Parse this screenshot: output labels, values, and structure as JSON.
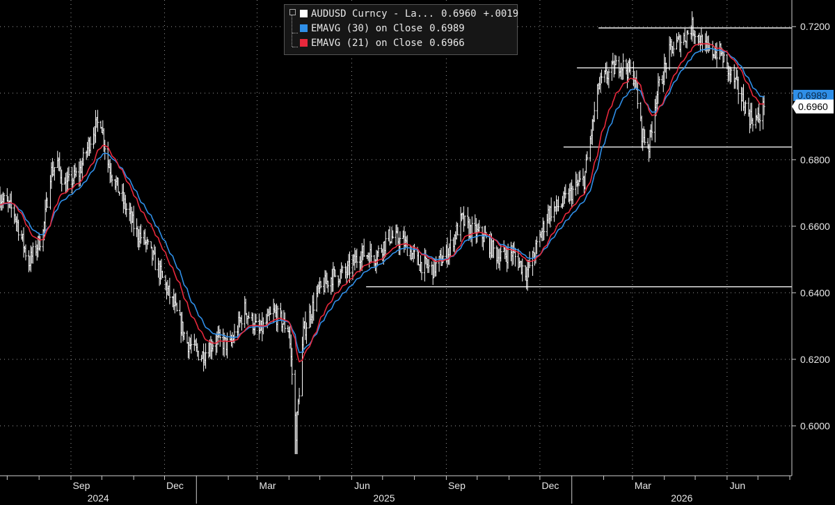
{
  "legend": {
    "main": {
      "label": "AUDUSD Curncy - La...",
      "value": "0.6960",
      "change": "+.0019",
      "color": "#ffffff"
    },
    "ema30": {
      "label": "EMAVG (30)  on Close",
      "value": "0.6989",
      "color": "#2f8fe8"
    },
    "ema21": {
      "label": "EMAVG (21)  on Close",
      "value": "0.6966",
      "color": "#e8283c"
    }
  },
  "chart_data": {
    "type": "line",
    "security": "AUDUSD Curncy",
    "ylim": [
      0.585,
      0.728
    ],
    "y_ticks": [
      "0.6000",
      "0.6200",
      "0.6400",
      "0.6600",
      "0.6800",
      "0.7000",
      "0.7200"
    ],
    "last_price_label": "0.6960",
    "ema30_label": "0.6989",
    "x_tick_labels": [
      "Sep",
      "Dec",
      "Mar",
      "Jun",
      "Sep",
      "Dec",
      "Mar",
      "Jun"
    ],
    "year_labels": [
      "2024",
      "2025",
      "2026"
    ],
    "x_start": "2024-06-24",
    "x_end": "2026-08-03",
    "price_path": [
      [
        "2024-06-24",
        0.669
      ],
      [
        "2024-07-08",
        0.664
      ],
      [
        "2024-07-22",
        0.649
      ],
      [
        "2024-08-05",
        0.658
      ],
      [
        "2024-08-12",
        0.676
      ],
      [
        "2024-08-19",
        0.679
      ],
      [
        "2024-08-26",
        0.672
      ],
      [
        "2024-09-09",
        0.676
      ],
      [
        "2024-09-23",
        0.689
      ],
      [
        "2024-09-30",
        0.692
      ],
      [
        "2024-10-07",
        0.679
      ],
      [
        "2024-10-21",
        0.668
      ],
      [
        "2024-11-04",
        0.658
      ],
      [
        "2024-11-11",
        0.656
      ],
      [
        "2024-11-25",
        0.647
      ],
      [
        "2024-12-09",
        0.637
      ],
      [
        "2024-12-23",
        0.625
      ],
      [
        "2025-01-06",
        0.621
      ],
      [
        "2025-01-20",
        0.626
      ],
      [
        "2025-02-03",
        0.624
      ],
      [
        "2025-02-17",
        0.635
      ],
      [
        "2025-03-03",
        0.628
      ],
      [
        "2025-03-17",
        0.634
      ],
      [
        "2025-04-01",
        0.629
      ],
      [
        "2025-04-08",
        0.598
      ],
      [
        "2025-04-15",
        0.628
      ],
      [
        "2025-04-29",
        0.64
      ],
      [
        "2025-05-13",
        0.645
      ],
      [
        "2025-05-27",
        0.646
      ],
      [
        "2025-06-10",
        0.652
      ],
      [
        "2025-06-24",
        0.651
      ],
      [
        "2025-07-08",
        0.657
      ],
      [
        "2025-07-22",
        0.655
      ],
      [
        "2025-08-05",
        0.649
      ],
      [
        "2025-08-19",
        0.647
      ],
      [
        "2025-09-02",
        0.652
      ],
      [
        "2025-09-16",
        0.662
      ],
      [
        "2025-09-23",
        0.659
      ],
      [
        "2025-10-07",
        0.657
      ],
      [
        "2025-10-21",
        0.651
      ],
      [
        "2025-11-04",
        0.652
      ],
      [
        "2025-11-18",
        0.646
      ],
      [
        "2025-11-25",
        0.651
      ],
      [
        "2025-12-09",
        0.664
      ],
      [
        "2025-12-23",
        0.667
      ],
      [
        "2026-01-06",
        0.672
      ],
      [
        "2026-01-13",
        0.674
      ],
      [
        "2026-01-20",
        0.688
      ],
      [
        "2026-01-27",
        0.702
      ],
      [
        "2026-02-03",
        0.705
      ],
      [
        "2026-02-17",
        0.709
      ],
      [
        "2026-03-03",
        0.705
      ],
      [
        "2026-03-10",
        0.688
      ],
      [
        "2026-03-17",
        0.684
      ],
      [
        "2026-03-24",
        0.699
      ],
      [
        "2026-04-07",
        0.713
      ],
      [
        "2026-04-21",
        0.717
      ],
      [
        "2026-04-28",
        0.72
      ],
      [
        "2026-05-12",
        0.713
      ],
      [
        "2026-05-26",
        0.712
      ],
      [
        "2026-06-02",
        0.707
      ],
      [
        "2026-06-09",
        0.703
      ],
      [
        "2026-06-16",
        0.698
      ],
      [
        "2026-06-23",
        0.693
      ],
      [
        "2026-07-01",
        0.692
      ],
      [
        "2026-07-07",
        0.696
      ]
    ],
    "horizontal_levels": [
      {
        "value": 0.7196,
        "from": "2026-01-27",
        "to": "2026-08-03"
      },
      {
        "value": 0.7076,
        "from": "2026-01-06",
        "to": "2026-08-03"
      },
      {
        "value": 0.6838,
        "from": "2025-12-24",
        "to": "2026-08-03"
      },
      {
        "value": 0.6418,
        "from": "2025-06-15",
        "to": "2026-08-03"
      }
    ]
  },
  "colors": {
    "background": "#000000",
    "grid": "#9a9a9a",
    "price": "#ffffff",
    "ema30": "#2f8fe8",
    "ema21": "#e8283c"
  }
}
